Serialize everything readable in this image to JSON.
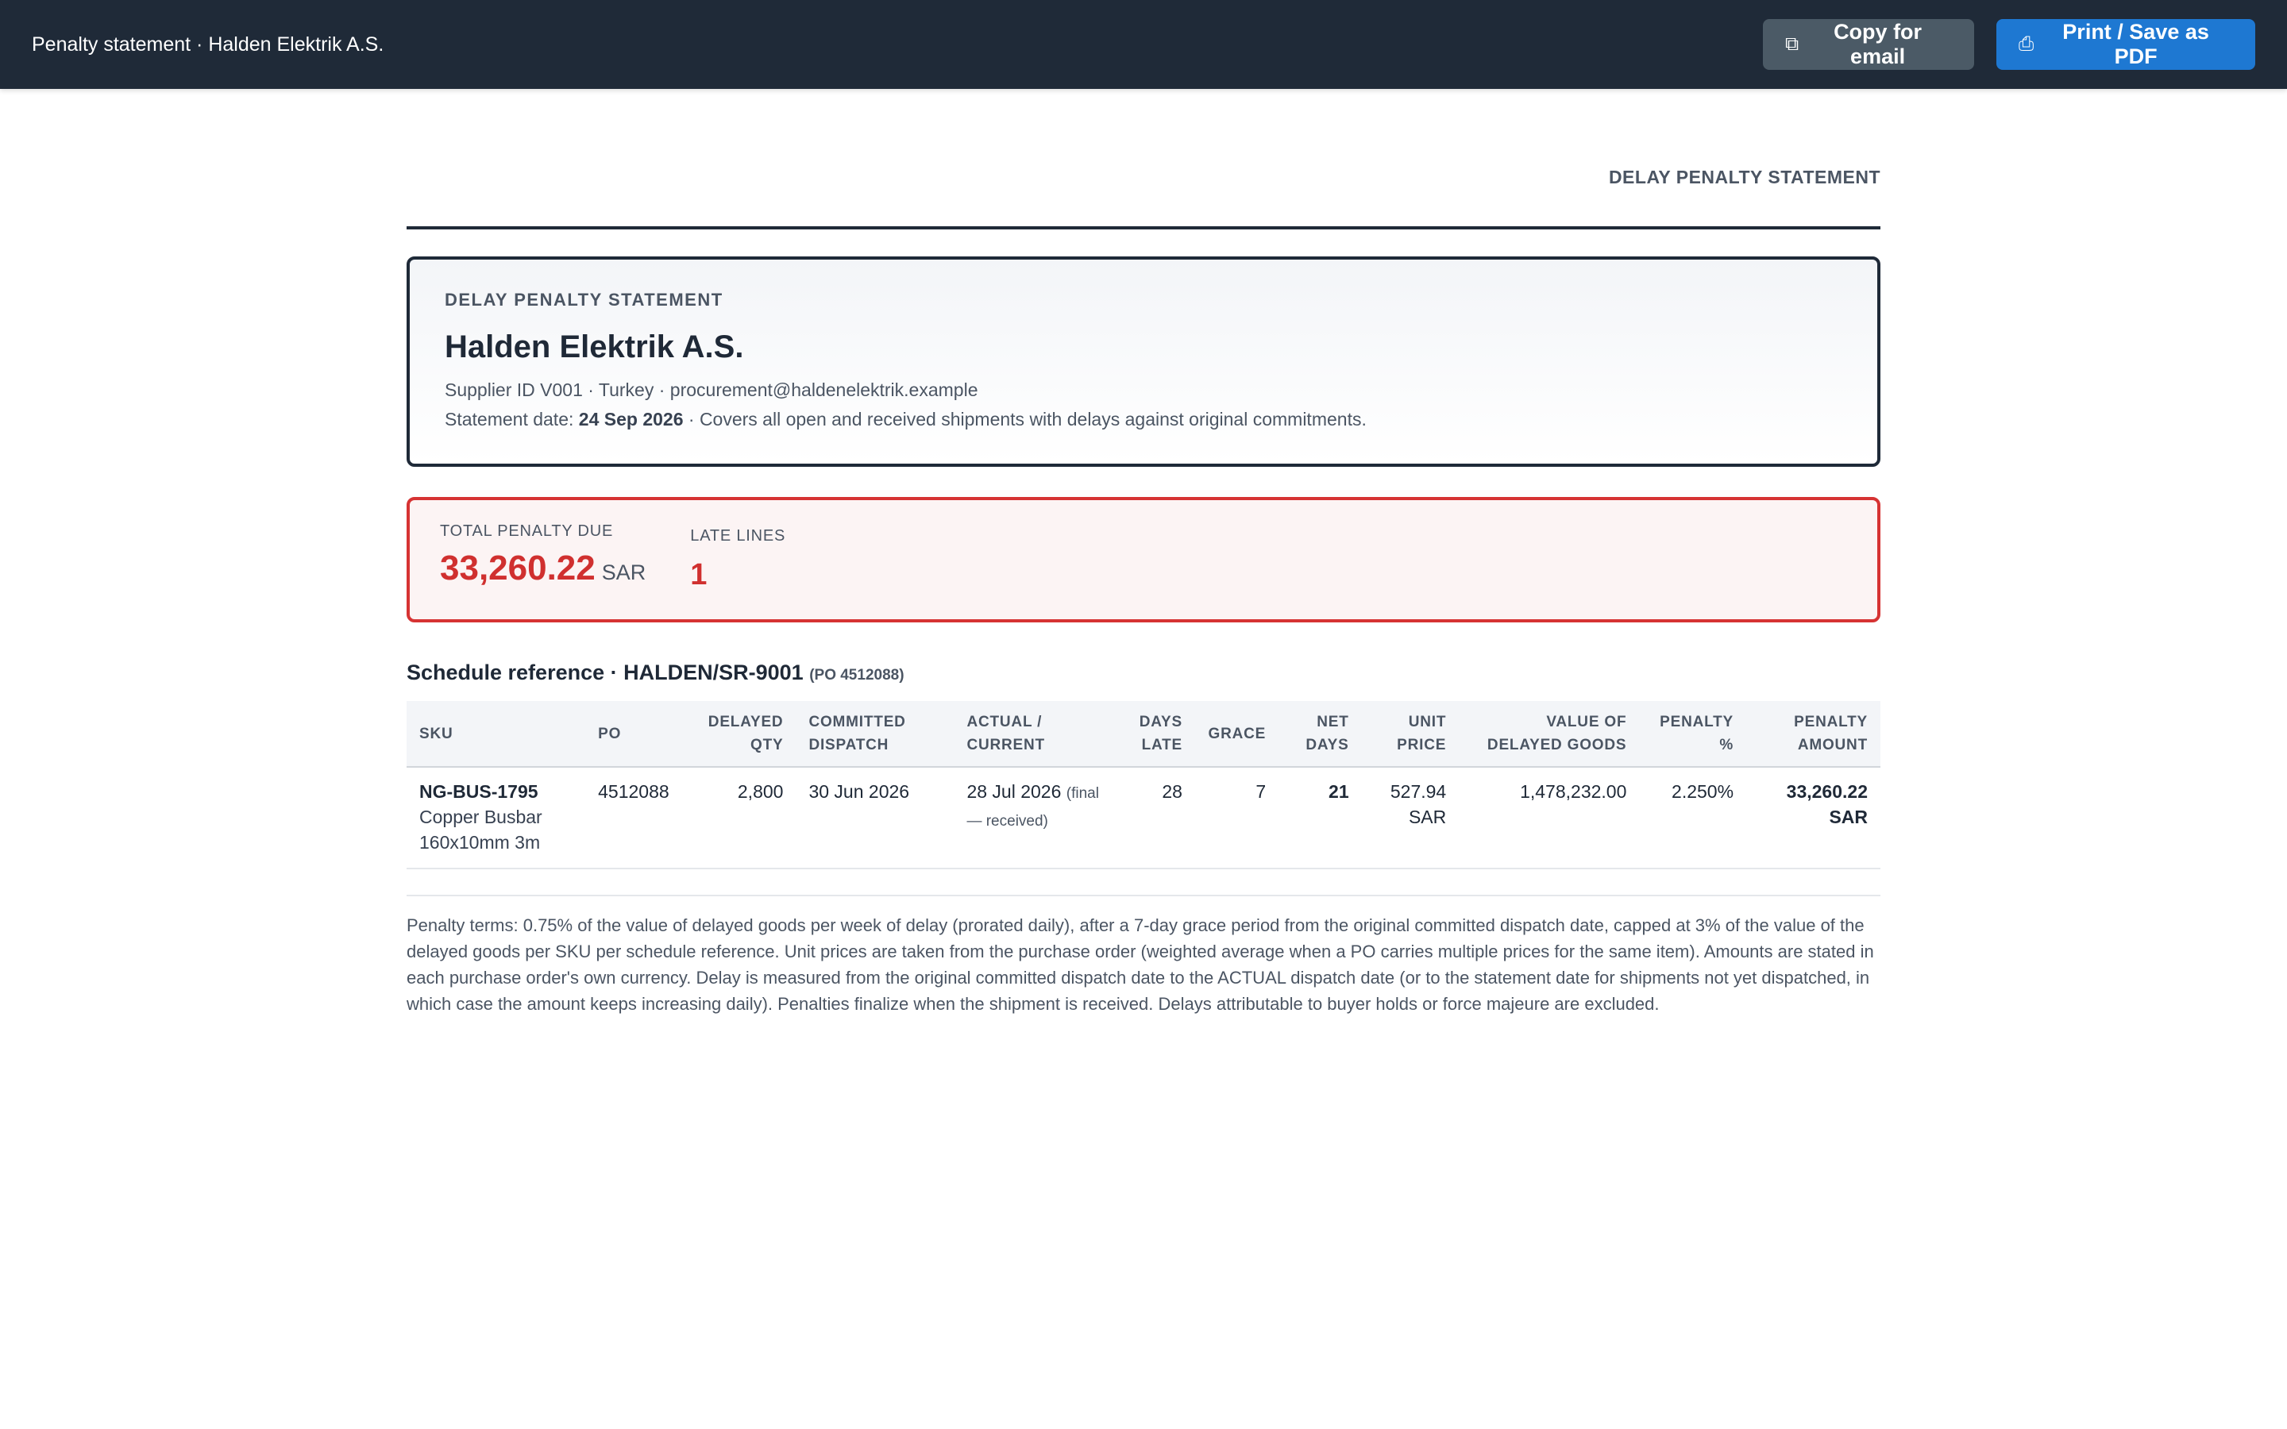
{
  "topbar": {
    "title": "Penalty statement · Halden Elektrik A.S.",
    "copy_icon": "copy-icon",
    "copy_glyph": "⧉",
    "copy_label": "Copy for email",
    "print_icon": "printer-icon",
    "print_glyph": "⎙",
    "print_label": "Print / Save as PDF"
  },
  "document": {
    "label": "DELAY PENALTY STATEMENT"
  },
  "supplier": {
    "kicker": "DELAY PENALTY STATEMENT",
    "name": "Halden Elektrik A.S.",
    "meta": "Supplier ID V001 · Turkey · procurement@haldenelektrik.example",
    "statement_date_prefix": "Statement date: ",
    "statement_date": "24 Sep 2026",
    "statement_date_suffix": " · Covers all open and received shipments with delays against original commitments."
  },
  "summary": {
    "total_label": "TOTAL PENALTY DUE",
    "total_value": "33,260.22",
    "total_currency": "SAR",
    "late_label": "LATE LINES",
    "late_value": "1"
  },
  "schedule": {
    "title": "Schedule reference · HALDEN/SR-9001",
    "po_note": "(PO 4512088)",
    "columns": {
      "sku": "SKU",
      "po": "PO",
      "delayed_qty_1": "DELAYED",
      "delayed_qty_2": "QTY",
      "committed_1": "COMMITTED",
      "committed_2": "DISPATCH",
      "actual_1": "ACTUAL /",
      "actual_2": "CURRENT",
      "days_late_1": "DAYS",
      "days_late_2": "LATE",
      "grace": "GRACE",
      "net_days_1": "NET",
      "net_days_2": "DAYS",
      "unit_price_1": "UNIT",
      "unit_price_2": "PRICE",
      "value_1": "VALUE OF",
      "value_2": "DELAYED GOODS",
      "penalty_pct_1": "PENALTY",
      "penalty_pct_2": "%",
      "penalty_amt_1": "PENALTY",
      "penalty_amt_2": "AMOUNT"
    },
    "rows": [
      {
        "sku_code": "NG-BUS-1795",
        "sku_desc_1": "Copper Busbar",
        "sku_desc_2": "160x10mm 3m",
        "po": "4512088",
        "delayed_qty": "2,800",
        "committed": "30 Jun 2026",
        "actual": "28 Jul 2026",
        "actual_note_1": "(final",
        "actual_note_2": "— received)",
        "days_late": "28",
        "grace": "7",
        "net_days": "21",
        "unit_price": "527.94",
        "unit_currency": "SAR",
        "value": "1,478,232.00",
        "penalty_pct": "2.250%",
        "penalty_amount": "33,260.22",
        "penalty_currency": "SAR"
      }
    ]
  },
  "terms": "Penalty terms: 0.75% of the value of delayed goods per week of delay (prorated daily), after a 7-day grace period from the original committed dispatch date, capped at 3% of the value of the delayed goods per SKU per schedule reference. Unit prices are taken from the purchase order (weighted average when a PO carries multiple prices for the same item). Amounts are stated in each purchase order's own currency. Delay is measured from the original committed dispatch date to the ACTUAL dispatch date (or to the statement date for shipments not yet dispatched, in which case the amount keeps increasing daily). Penalties finalize when the shipment is received. Delays attributable to buyer holds or force majeure are excluded."
}
